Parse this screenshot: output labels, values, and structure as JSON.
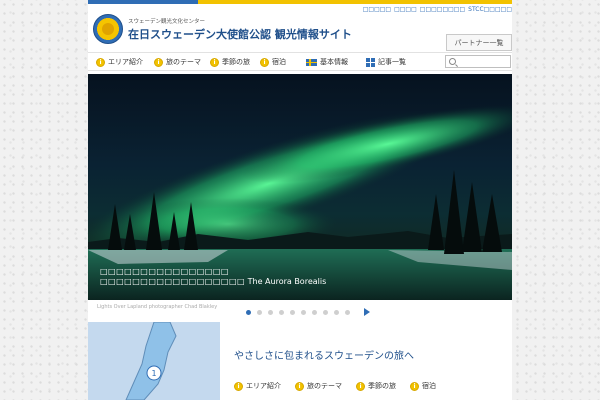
{
  "utility_links": [
    "□□□□□",
    "□□□□",
    "□□□□□□□□",
    "STCC□□□□□"
  ],
  "header": {
    "subtitle": "スウェーデン観光文化センター",
    "title": "在日スウェーデン大使館公認 観光情報サイト",
    "partner_button": "パートナー一覧"
  },
  "nav": {
    "items": [
      {
        "label": "エリア紹介",
        "icon": "info-icon"
      },
      {
        "label": "旅のテーマ",
        "icon": "info-icon"
      },
      {
        "label": "季節の旅",
        "icon": "info-icon"
      },
      {
        "label": "宿泊",
        "icon": "info-icon"
      },
      {
        "label": "基本情報",
        "icon": "swedish-flag-icon"
      },
      {
        "label": "記事一覧",
        "icon": "grid-icon"
      }
    ],
    "info_glyph": "i"
  },
  "search": {
    "placeholder": "",
    "icon": "search-icon"
  },
  "hero": {
    "caption_boxes": "□□□□□□□□□□□□□□□□ □□□□□□□□□□□□□□□□□□",
    "caption_text": "The Aurora Borealis"
  },
  "credit": "Lights Over Lapland photographer Chad Blakley",
  "carousel": {
    "total_slides": 10,
    "active_index": 0
  },
  "intro": {
    "title": "やさしさに包まれるスウェーデンの旅へ",
    "map_marker": "1",
    "tabs": [
      "エリア紹介",
      "旅のテーマ",
      "季節の旅",
      "宿泊"
    ]
  },
  "colors": {
    "brand_blue": "#2f6db5",
    "brand_yellow": "#f2c200"
  }
}
